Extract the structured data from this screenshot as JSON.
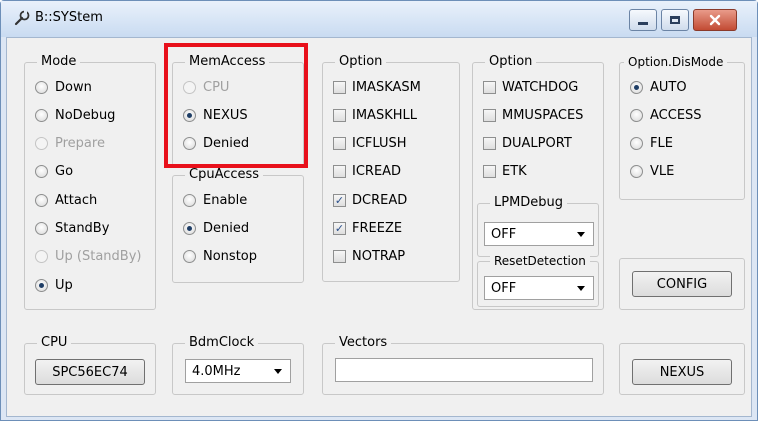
{
  "window": {
    "title": "B::SYStem"
  },
  "mode": {
    "title": "Mode",
    "items": [
      {
        "label": "Down",
        "checked": false,
        "disabled": false
      },
      {
        "label": "NoDebug",
        "checked": false,
        "disabled": false
      },
      {
        "label": "Prepare",
        "checked": false,
        "disabled": true
      },
      {
        "label": "Go",
        "checked": false,
        "disabled": false
      },
      {
        "label": "Attach",
        "checked": false,
        "disabled": false
      },
      {
        "label": "StandBy",
        "checked": false,
        "disabled": false
      },
      {
        "label": "Up (StandBy)",
        "checked": false,
        "disabled": true
      },
      {
        "label": "Up",
        "checked": true,
        "disabled": false
      }
    ]
  },
  "memaccess": {
    "title": "MemAccess",
    "items": [
      {
        "label": "CPU",
        "checked": false,
        "disabled": true
      },
      {
        "label": "NEXUS",
        "checked": true,
        "disabled": false
      },
      {
        "label": "Denied",
        "checked": false,
        "disabled": false
      }
    ]
  },
  "cpuaccess": {
    "title": "CpuAccess",
    "items": [
      {
        "label": "Enable",
        "checked": false,
        "disabled": false
      },
      {
        "label": "Denied",
        "checked": true,
        "disabled": false
      },
      {
        "label": "Nonstop",
        "checked": false,
        "disabled": false
      }
    ]
  },
  "option1": {
    "title": "Option",
    "items": [
      {
        "label": "IMASKASM",
        "checked": false
      },
      {
        "label": "IMASKHLL",
        "checked": false
      },
      {
        "label": "ICFLUSH",
        "checked": false
      },
      {
        "label": "ICREAD",
        "checked": false
      },
      {
        "label": "DCREAD",
        "checked": true
      },
      {
        "label": "FREEZE",
        "checked": true
      },
      {
        "label": "NOTRAP",
        "checked": false
      }
    ]
  },
  "option2": {
    "title": "Option",
    "items": [
      {
        "label": "WATCHDOG",
        "checked": false
      },
      {
        "label": "MMUSPACES",
        "checked": false
      },
      {
        "label": "DUALPORT",
        "checked": false
      },
      {
        "label": "ETK",
        "checked": false
      }
    ]
  },
  "lpmdebug": {
    "title": "LPMDebug",
    "value": "OFF"
  },
  "resetdetection": {
    "title": "ResetDetection",
    "value": "OFF"
  },
  "disMode": {
    "title": "Option.DisMode",
    "items": [
      {
        "label": "AUTO",
        "checked": true
      },
      {
        "label": "ACCESS",
        "checked": false
      },
      {
        "label": "FLE",
        "checked": false
      },
      {
        "label": "VLE",
        "checked": false
      }
    ]
  },
  "config_button": "CONFIG",
  "cpu": {
    "title": "CPU",
    "button": "SPC56EC74"
  },
  "bdmclock": {
    "title": "BdmClock",
    "value": "4.0MHz"
  },
  "vectors": {
    "title": "Vectors",
    "value": ""
  },
  "nexus_button": "NEXUS",
  "colors": {
    "highlight": "#e8101b",
    "titlebar": "#c9dbf1",
    "client": "#f0f0f0"
  }
}
